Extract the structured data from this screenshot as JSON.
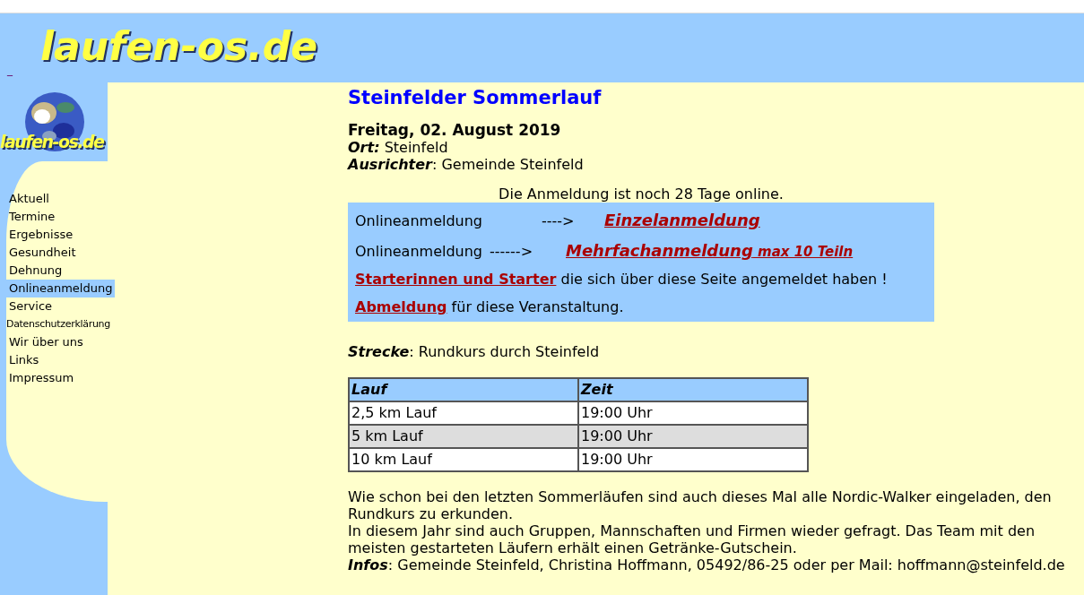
{
  "header": {
    "logo": "laufen-os.de",
    "mark": "_"
  },
  "sidebar": {
    "logo": "laufen-os.de",
    "items": [
      {
        "label": "Aktuell",
        "kind": "normal",
        "selected": false
      },
      {
        "label": "Termine",
        "kind": "normal",
        "selected": false
      },
      {
        "label": "Ergebnisse",
        "kind": "normal",
        "selected": false
      },
      {
        "label": "Gesundheit",
        "kind": "normal",
        "selected": false
      },
      {
        "label": "Dehnung",
        "kind": "normal",
        "selected": false
      },
      {
        "label": "Onlineanmeldung",
        "kind": "normal",
        "selected": true
      },
      {
        "label": "Service",
        "kind": "normal",
        "selected": false
      },
      {
        "label": "Datenschutzerklärung",
        "kind": "compact",
        "selected": false
      },
      {
        "label": "Wir über uns",
        "kind": "normal",
        "selected": false
      },
      {
        "label": "Links",
        "kind": "normal",
        "selected": false
      },
      {
        "label": "Impressum",
        "kind": "normal",
        "selected": false
      }
    ]
  },
  "event": {
    "title": "Steinfelder Sommerlauf",
    "date": "Freitag, 02. August 2019",
    "info": [
      {
        "label": "Ort:",
        "value": " Steinfeld"
      },
      {
        "label": "Ausrichter",
        "value": ": Gemeinde Steinfeld"
      }
    ],
    "notice": "Die Anmeldung ist noch 28 Tage online."
  },
  "registration": [
    {
      "kind": "arrow",
      "text": "Onlineanmeldung",
      "arrow": "---->",
      "link": "Einzelanmeldung"
    },
    {
      "kind": "arrow",
      "text": "Onlineanmeldung",
      "arrow": "------>",
      "link": "Mehrfachanmeldung",
      "link_note": " max 10 Teiln"
    },
    {
      "kind": "sentence",
      "link": "Starterinnen und Starter",
      "text": " die sich über diese Seite angemeldet haben !"
    },
    {
      "kind": "sentence",
      "link": "Abmeldung",
      "text": " für diese Veranstaltung."
    }
  ],
  "route": {
    "label": "Strecke",
    "value": ": Rundkurs durch Steinfeld"
  },
  "table": {
    "columns": [
      "Lauf",
      "Zeit"
    ],
    "rows": [
      [
        "2,5 km Lauf",
        "19:00 Uhr"
      ],
      [
        "5 km Lauf",
        "19:00 Uhr"
      ],
      [
        "10 km Lauf",
        "19:00 Uhr"
      ]
    ]
  },
  "paragraphs": [
    "Wie schon bei den letzten Sommerläufen sind auch dieses Mal alle Nordic-Walker eingeladen, den Rundkurs zu erkunden.",
    "In diesem Jahr sind auch Gruppen, Mannschaften und Firmen wieder gefragt. Das Team mit den meisten gestarteten Läufern erhält einen Getränke-Gutschein."
  ],
  "contact": {
    "label": "Infos",
    "value": ": Gemeinde Steinfeld, Christina Hoffmann, 05492/86-25 oder per Mail: hoffmann@steinfeld.de"
  }
}
